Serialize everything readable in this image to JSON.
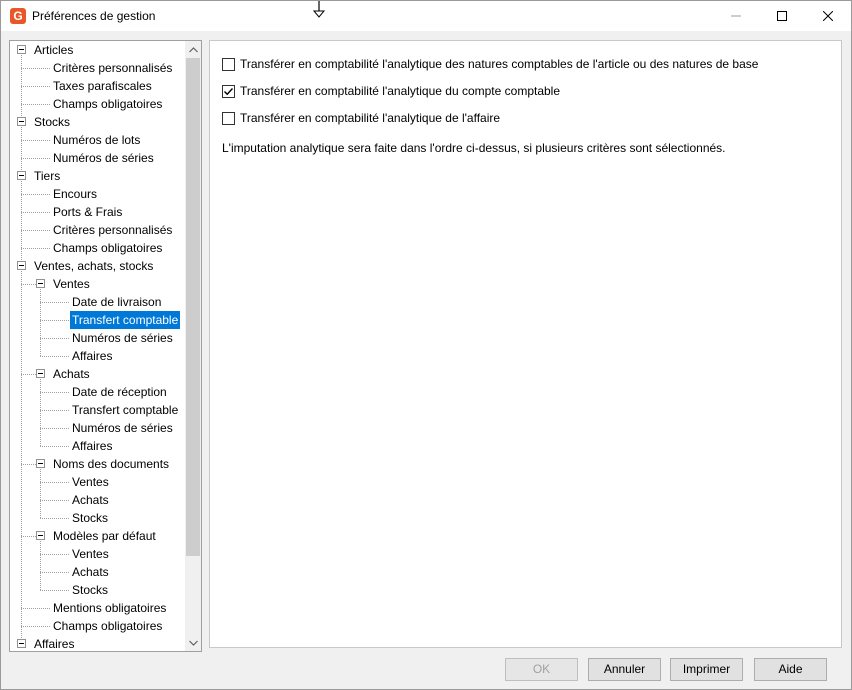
{
  "window": {
    "title": "Préférences de gestion",
    "app_icon_letter": "G",
    "accent_color": "#e8572a",
    "selection_color": "#0078d7"
  },
  "tree": {
    "items": [
      {
        "label": "Articles",
        "level": 0,
        "expander": true
      },
      {
        "label": "Critères personnalisés",
        "level": 1
      },
      {
        "label": "Taxes parafiscales",
        "level": 1
      },
      {
        "label": "Champs obligatoires",
        "level": 1
      },
      {
        "label": "Stocks",
        "level": 0,
        "expander": true
      },
      {
        "label": "Numéros de lots",
        "level": 1
      },
      {
        "label": "Numéros de séries",
        "level": 1
      },
      {
        "label": "Tiers",
        "level": 0,
        "expander": true
      },
      {
        "label": "Encours",
        "level": 1
      },
      {
        "label": "Ports & Frais",
        "level": 1
      },
      {
        "label": "Critères personnalisés",
        "level": 1
      },
      {
        "label": "Champs obligatoires",
        "level": 1
      },
      {
        "label": "Ventes, achats, stocks",
        "level": 0,
        "expander": true
      },
      {
        "label": "Ventes",
        "level": 1,
        "expander": true
      },
      {
        "label": "Date de livraison",
        "level": 2
      },
      {
        "label": "Transfert comptable",
        "level": 2,
        "selected": true
      },
      {
        "label": "Numéros de séries",
        "level": 2
      },
      {
        "label": "Affaires",
        "level": 2
      },
      {
        "label": "Achats",
        "level": 1,
        "expander": true
      },
      {
        "label": "Date de réception",
        "level": 2
      },
      {
        "label": "Transfert comptable",
        "level": 2
      },
      {
        "label": "Numéros de séries",
        "level": 2
      },
      {
        "label": "Affaires",
        "level": 2
      },
      {
        "label": "Noms des documents",
        "level": 1,
        "expander": true
      },
      {
        "label": "Ventes",
        "level": 2
      },
      {
        "label": "Achats",
        "level": 2
      },
      {
        "label": "Stocks",
        "level": 2
      },
      {
        "label": "Modèles par défaut",
        "level": 1,
        "expander": true
      },
      {
        "label": "Ventes",
        "level": 2
      },
      {
        "label": "Achats",
        "level": 2
      },
      {
        "label": "Stocks",
        "level": 2
      },
      {
        "label": "Mentions obligatoires",
        "level": 1
      },
      {
        "label": "Champs obligatoires",
        "level": 1
      },
      {
        "label": "Affaires",
        "level": 0,
        "expander": true
      }
    ]
  },
  "options": [
    {
      "label": "Transférer en comptabilité l'analytique des natures comptables de l'article ou des natures de base",
      "checked": false
    },
    {
      "label": "Transférer en comptabilité l'analytique du compte comptable",
      "checked": true
    },
    {
      "label": "Transférer en comptabilité l'analytique de l'affaire",
      "checked": false
    }
  ],
  "info": "L'imputation analytique sera faite dans l'ordre ci-dessus, si plusieurs critères sont sélectionnés.",
  "buttons": {
    "ok": "OK",
    "cancel": "Annuler",
    "print": "Imprimer",
    "help": "Aide"
  }
}
